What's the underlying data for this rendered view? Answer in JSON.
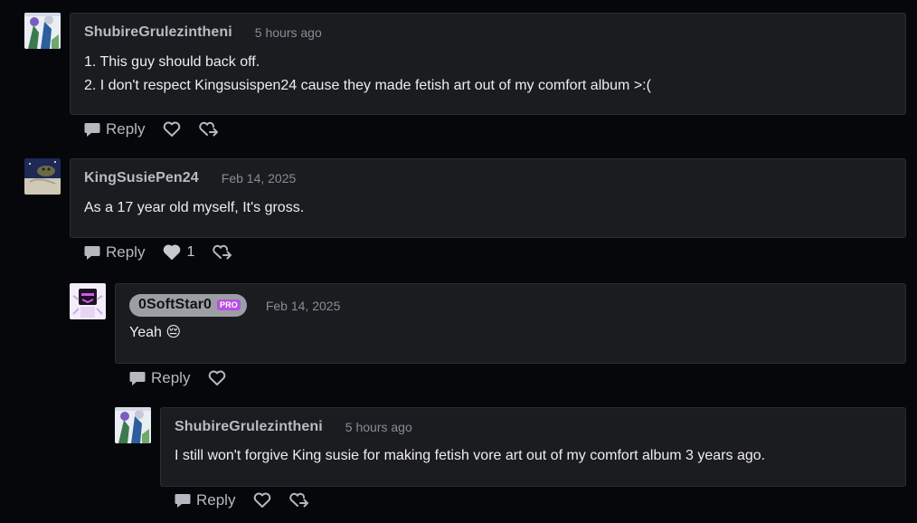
{
  "comments": [
    {
      "username": "ShubireGrulezintheni",
      "timestamp": "5 hours ago",
      "lines": [
        "1. This guy should back off.",
        "2. I don't respect Kingsusispen24 cause they made fetish art out of my comfort album >:("
      ],
      "reply_label": "Reply"
    },
    {
      "username": "KingSusiePen24",
      "timestamp": "Feb 14, 2025",
      "lines": [
        "As a 17 year old myself, It's gross."
      ],
      "reply_label": "Reply",
      "like_count": "1"
    },
    {
      "username": "0SoftStar0",
      "badge": "PRO",
      "timestamp": "Feb 14, 2025",
      "lines": [
        "Yeah 😔"
      ],
      "reply_label": "Reply"
    },
    {
      "username": "ShubireGrulezintheni",
      "timestamp": "5 hours ago",
      "lines": [
        "I still won't forgive King susie for making fetish vore art out of my comfort album 3 years ago."
      ],
      "reply_label": "Reply"
    }
  ],
  "colors": {
    "background": "#06070a",
    "bubble": "#1b1c20",
    "pro_badge": "#b84fe0"
  },
  "icons": [
    "speech-bubble-icon",
    "heart-icon",
    "heart-filled-icon",
    "share-icon"
  ]
}
